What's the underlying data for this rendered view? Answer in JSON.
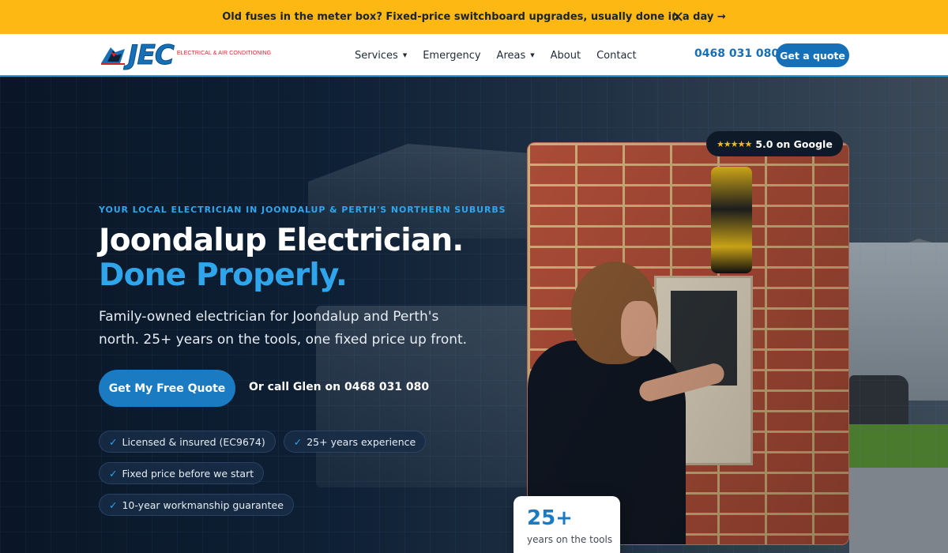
{
  "announcement": {
    "text": "Old fuses in the meter box? Fixed-price switchboard upgrades, usually done in a day →",
    "close_icon": "close-icon"
  },
  "header": {
    "logo": {
      "wordmark": "JEC",
      "tagline": "ELECTRICAL & AIR CONDITIONING",
      "icon": "lightning-bolt-icon"
    },
    "nav": [
      {
        "label": "Services",
        "has_dropdown": true
      },
      {
        "label": "Emergency",
        "has_dropdown": false
      },
      {
        "label": "Areas",
        "has_dropdown": true
      },
      {
        "label": "About",
        "has_dropdown": false
      },
      {
        "label": "Contact",
        "has_dropdown": false
      }
    ],
    "phone": "0468 031 080",
    "quote_button": "Get a quote"
  },
  "hero": {
    "eyebrow": "YOUR LOCAL ELECTRICIAN IN JOONDALUP & PERTH'S NORTHERN SUBURBS",
    "heading_line1": "Joondalup Electrician.",
    "heading_line2": "Done Properly.",
    "lead": "Family-owned electrician for Joondalup and Perth's north. 25+ years on the tools, one fixed price up front.",
    "cta_primary": "Get My Free Quote",
    "cta_secondary": "Or call Glen on 0468 031 080",
    "badges": [
      "Licensed & insured (EC9674)",
      "25+ years experience",
      "Fixed price before we start",
      "10-year workmanship guarantee"
    ],
    "badge_check": "✓",
    "rating": {
      "stars": "★★★★★",
      "label": "5.0 on Google"
    },
    "stat": {
      "value": "25+",
      "label": "years on the tools"
    }
  },
  "colors": {
    "announce_bg": "#fdb813",
    "brand_blue": "#1570b8",
    "accent_blue": "#2fa6ec",
    "hero_bg": "#0b1a2c"
  }
}
